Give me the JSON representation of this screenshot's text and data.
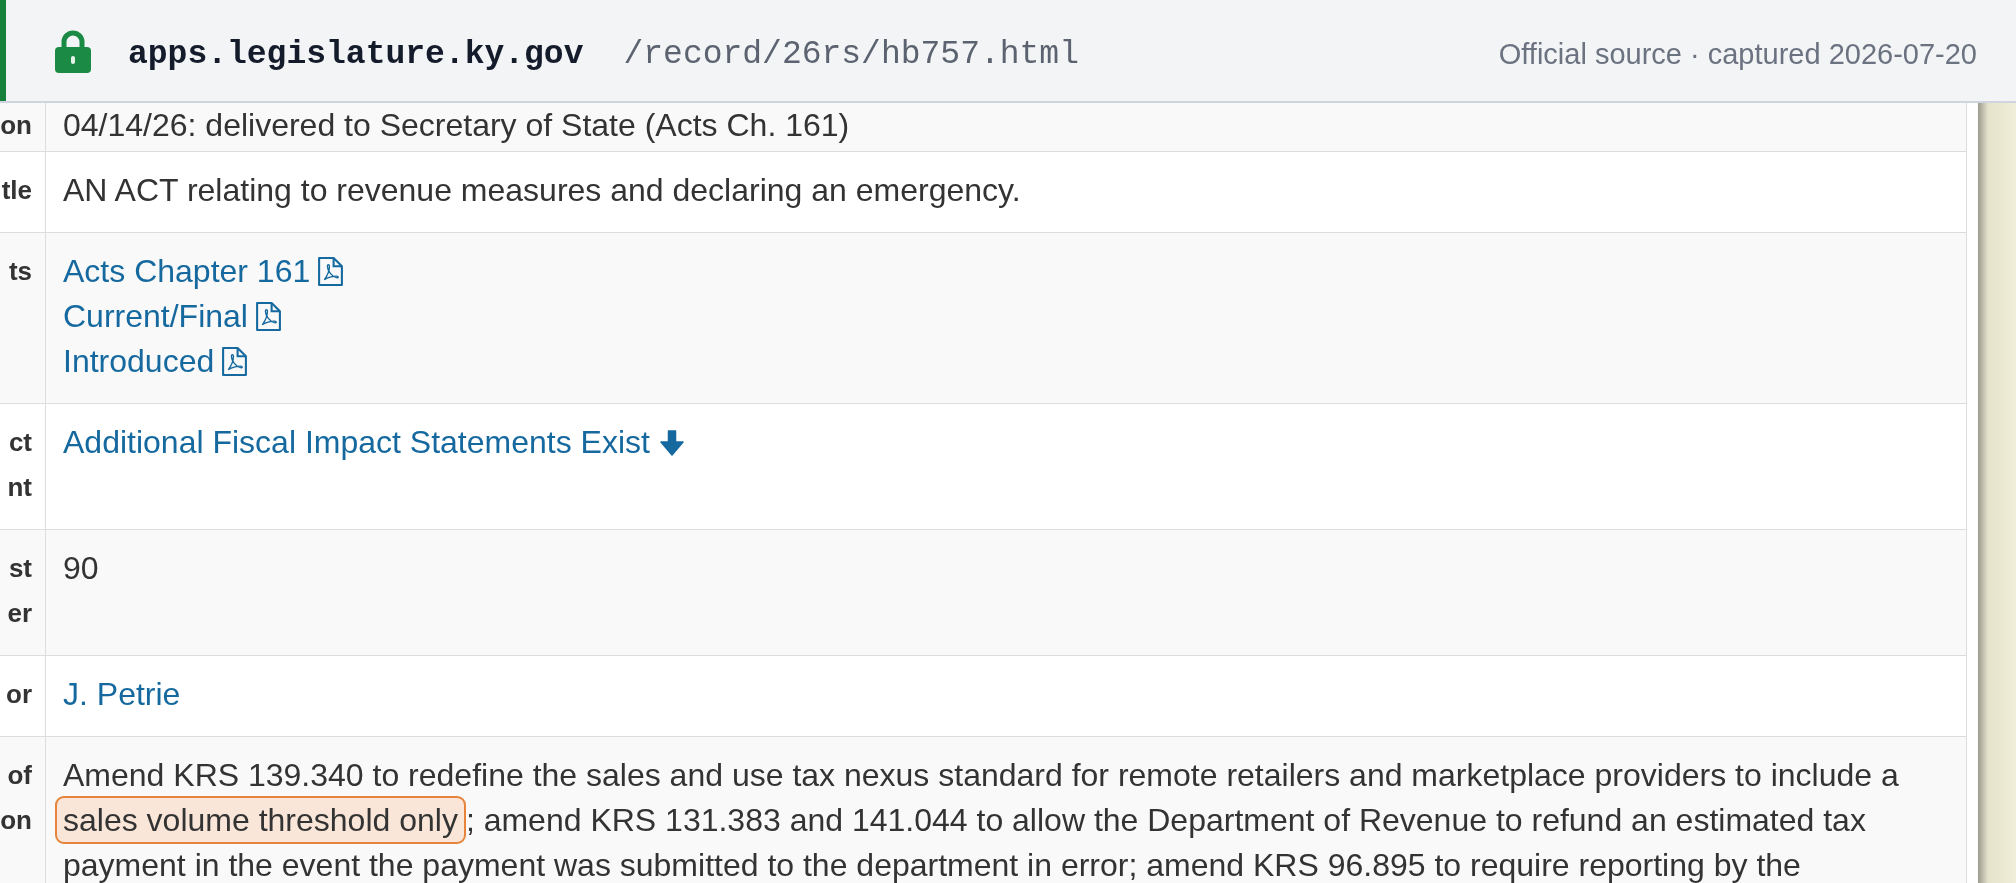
{
  "header": {
    "domain": "apps.legislature.ky.gov",
    "path": "/record/26rs/hb757.html",
    "source_note": "Official source · captured 2026-07-20"
  },
  "rows": [
    {
      "label": [
        "on"
      ],
      "kind": "text",
      "value": "04/14/26: delivered to Secretary of State (Acts Ch. 161)"
    },
    {
      "label": [
        "tle"
      ],
      "kind": "text",
      "value": "AN ACT relating to revenue measures and declaring an emergency."
    },
    {
      "label": [
        "ts"
      ],
      "kind": "documents",
      "links": [
        "Acts Chapter 161",
        "Current/Final",
        "Introduced"
      ]
    },
    {
      "label": [
        "ct",
        "nt"
      ],
      "kind": "jump_link",
      "link": "Additional Fiscal Impact Statements Exist"
    },
    {
      "label": [
        "st",
        "er"
      ],
      "kind": "text",
      "value": "90"
    },
    {
      "label": [
        "or"
      ],
      "kind": "link",
      "link": "J. Petrie"
    },
    {
      "label": [
        "of",
        "on"
      ],
      "kind": "summary",
      "before": "Amend KRS 139.340 to redefine the sales and use tax nexus standard for remote retailers and marketplace providers to include a",
      "highlight": "sales volume threshold only",
      "after": "; amend KRS 131.383 and 141.044 to allow the Department of Revenue to refund an estimated tax payment in the event the payment was submitted to the department in error; amend KRS 96.895 to require reporting by the"
    }
  ]
}
